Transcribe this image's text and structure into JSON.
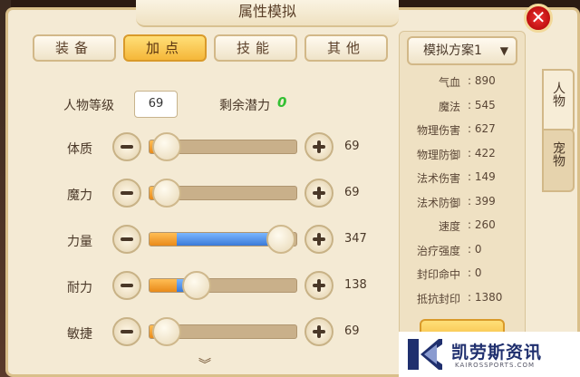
{
  "window": {
    "title": "属性模拟"
  },
  "colors": {
    "accent_gold": "#f5b739",
    "potential_green": "#33c033",
    "bar_orange": "#e98a1a",
    "bar_blue": "#3a7ad8",
    "close_red": "#d11"
  },
  "icons": {
    "close": "close-icon",
    "minus": "minus-icon",
    "plus": "plus-icon",
    "dropdown": "chevron-down-icon",
    "scroll": "chevron-down-icon"
  },
  "tabs": [
    {
      "label": "装备",
      "active": false
    },
    {
      "label": "加点",
      "active": true
    },
    {
      "label": "技能",
      "active": false
    },
    {
      "label": "其他",
      "active": false
    }
  ],
  "level": {
    "label": "人物等级",
    "value": "69"
  },
  "potential": {
    "label": "剩余潜力",
    "value": "0"
  },
  "attributes": [
    {
      "name": "体质",
      "value": "69",
      "orange_fraction": 0.05,
      "blue_fraction": 0.0
    },
    {
      "name": "魔力",
      "value": "69",
      "orange_fraction": 0.05,
      "blue_fraction": 0.0
    },
    {
      "name": "力量",
      "value": "347",
      "orange_fraction": 0.18,
      "blue_fraction": 0.64
    },
    {
      "name": "耐力",
      "value": "138",
      "orange_fraction": 0.18,
      "blue_fraction": 0.07
    },
    {
      "name": "敏捷",
      "value": "69",
      "orange_fraction": 0.05,
      "blue_fraction": 0.0
    }
  ],
  "scheme": {
    "label": "模拟方案1"
  },
  "stats": [
    {
      "label": "气血",
      "value": "890"
    },
    {
      "label": "魔法",
      "value": "545"
    },
    {
      "label": "物理伤害",
      "value": "627"
    },
    {
      "label": "物理防御",
      "value": "422"
    },
    {
      "label": "法术伤害",
      "value": "149"
    },
    {
      "label": "法术防御",
      "value": "399"
    },
    {
      "label": "速度",
      "value": "260"
    },
    {
      "label": "治疗强度",
      "value": "0"
    },
    {
      "label": "封印命中",
      "value": "0"
    },
    {
      "label": "抵抗封印",
      "value": "1380"
    }
  ],
  "side_tabs": [
    {
      "label": "人物",
      "active": true
    },
    {
      "label": "宠物",
      "active": false
    }
  ],
  "watermark": {
    "name": "凯劳斯资讯",
    "site": "KAIROSSPORTS.COM"
  }
}
